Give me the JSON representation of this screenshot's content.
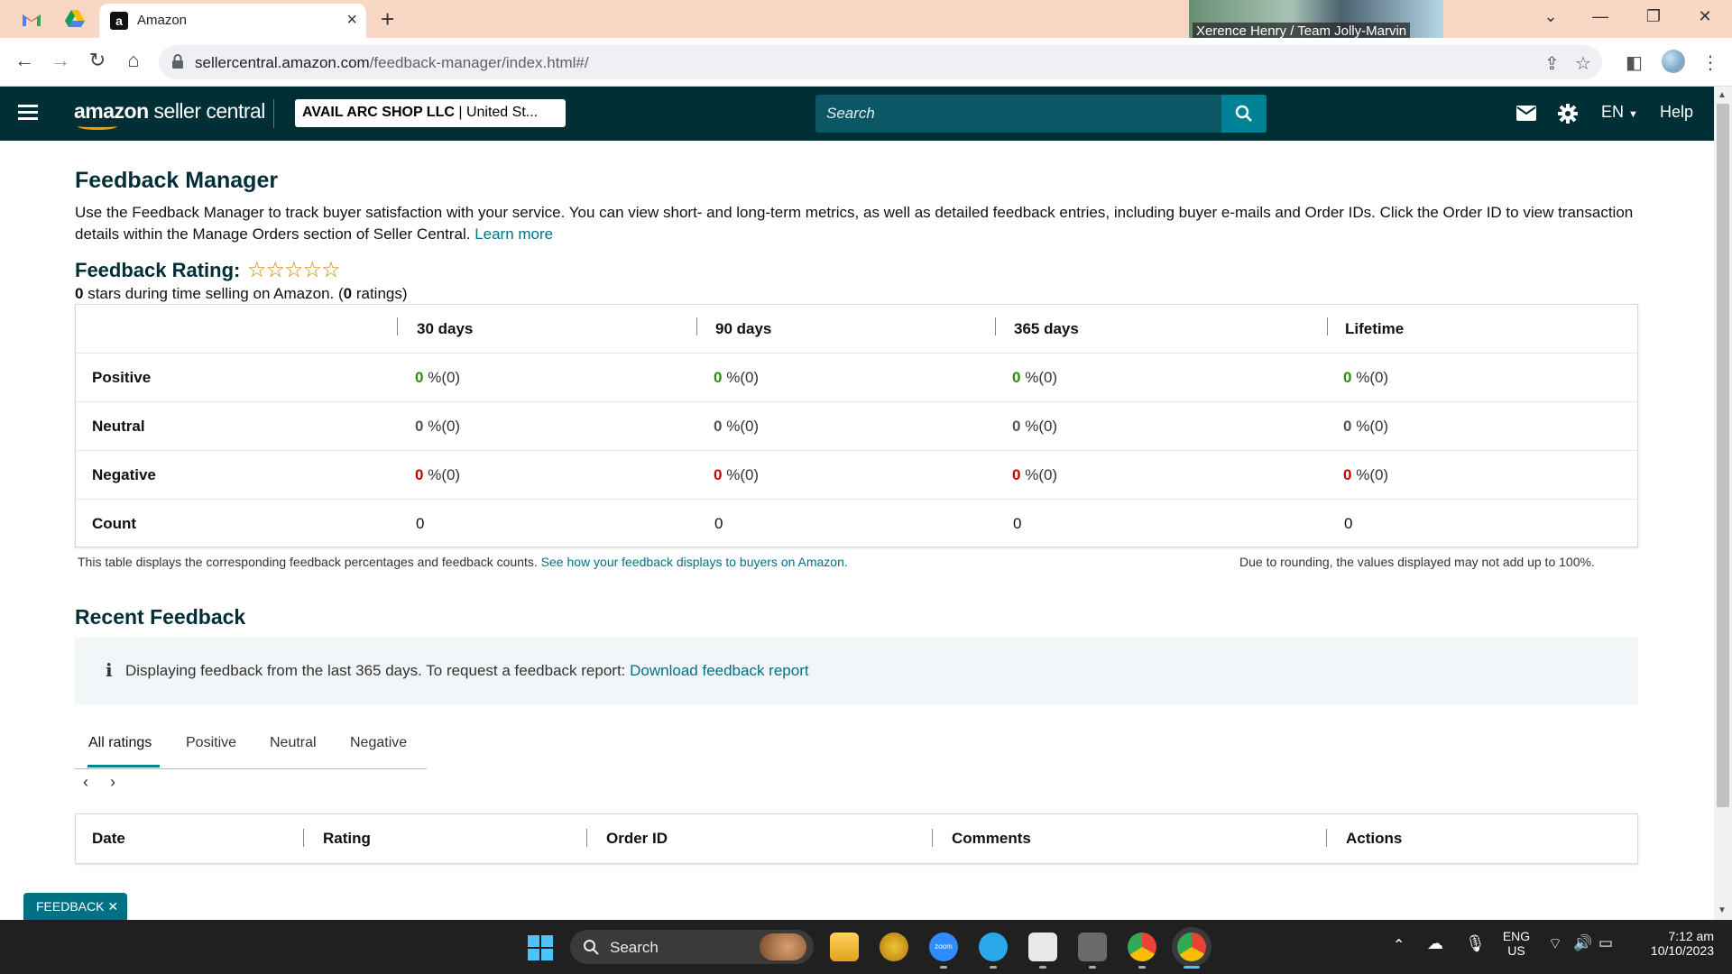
{
  "browser": {
    "active_tab_title": "Amazon",
    "url_host": "sellercentral.amazon.com",
    "url_path": "/feedback-manager/index.html#/",
    "video_overlay_label": "Xerence Henry / Team Jolly-Marvin"
  },
  "header": {
    "logo_bold": "amazon",
    "logo_rest": " seller central",
    "store_name": "AVAIL ARC SHOP LLC",
    "store_suffix": " | United St...",
    "search_placeholder": "Search",
    "language": "EN",
    "help": "Help"
  },
  "page": {
    "title": "Feedback Manager",
    "intro": "Use the Feedback Manager to track buyer satisfaction with your service. You can view short- and long-term metrics, as well as detailed feedback entries, including buyer e-mails and Order IDs. Click the Order ID to view transaction details within the Manage Orders section of Seller Central.",
    "learn_more": "Learn more",
    "rating_title": "Feedback Rating:",
    "stars": "☆☆☆☆☆",
    "rating_stars_value": "0",
    "rating_mid": " stars during time selling on Amazon. (",
    "rating_count": "0",
    "rating_end": " ratings)"
  },
  "feedback_table": {
    "columns": [
      "30 days",
      "90 days",
      "365 days",
      "Lifetime"
    ],
    "rows": [
      {
        "label": "Positive",
        "values": [
          "0",
          "0",
          "0",
          "0"
        ],
        "suffix": "%(0)"
      },
      {
        "label": "Neutral",
        "values": [
          "0",
          "0",
          "0",
          "0"
        ],
        "suffix": "%(0)"
      },
      {
        "label": "Negative",
        "values": [
          "0",
          "0",
          "0",
          "0"
        ],
        "suffix": "%(0)"
      },
      {
        "label": "Count",
        "values": [
          "0",
          "0",
          "0",
          "0"
        ]
      }
    ],
    "note": "This table displays the corresponding feedback percentages and feedback counts.",
    "note_link": "See how your feedback displays to buyers on Amazon.",
    "note_right": "Due to rounding, the values displayed may not add up to 100%."
  },
  "recent": {
    "title": "Recent Feedback",
    "info_text": "Displaying feedback from the last 365 days. To request a feedback report:",
    "info_link": "Download feedback report",
    "tabs": [
      "All ratings",
      "Positive",
      "Neutral",
      "Negative"
    ],
    "columns": [
      "Date",
      "Rating",
      "Order ID",
      "Comments",
      "Actions"
    ]
  },
  "feedback_button": "FEEDBACK ✕",
  "taskbar": {
    "search": "Search",
    "lang_top": "ENG",
    "lang_bottom": "US",
    "time": "7:12 am",
    "date": "10/10/2023"
  }
}
